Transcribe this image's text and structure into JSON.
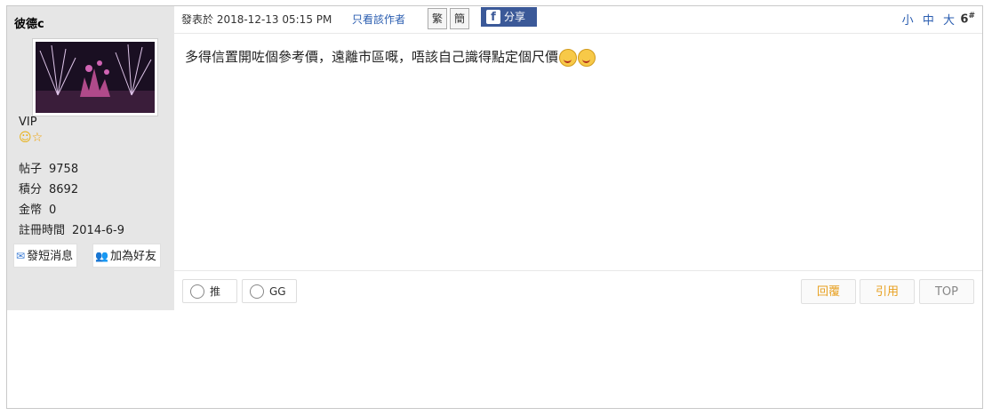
{
  "user": {
    "name": "彼德c",
    "rank": "VIP",
    "stats": [
      {
        "label": "帖子",
        "value": "9758"
      },
      {
        "label": "積分",
        "value": "8692"
      },
      {
        "label": "金幣",
        "value": "0"
      },
      {
        "label": "註冊時間",
        "value": "2014-6-9"
      }
    ],
    "buttons": {
      "message": "發短消息",
      "add_friend": "加為好友"
    }
  },
  "post": {
    "posted_at": "發表於 2018-12-13 05:15 PM",
    "only_author": "只看該作者",
    "lang_traditional": "繁",
    "lang_simplified": "簡",
    "share_label": "分享",
    "font_sizes": [
      "小",
      "中",
      "大"
    ],
    "floor": "6",
    "floor_suffix": "#",
    "content": "多得信置開咗個參考價，遠離市區嘅，唔該自己識得點定個尺價"
  },
  "actions": {
    "push": "推",
    "gg": "GG",
    "reply": "回覆",
    "quote": "引用",
    "top": "TOP"
  },
  "colors": {
    "sidebar_bg": "#e6e6e6",
    "link_blue": "#2a5db0",
    "facebook": "#3b5998",
    "reply_orange": "#e8a020"
  }
}
